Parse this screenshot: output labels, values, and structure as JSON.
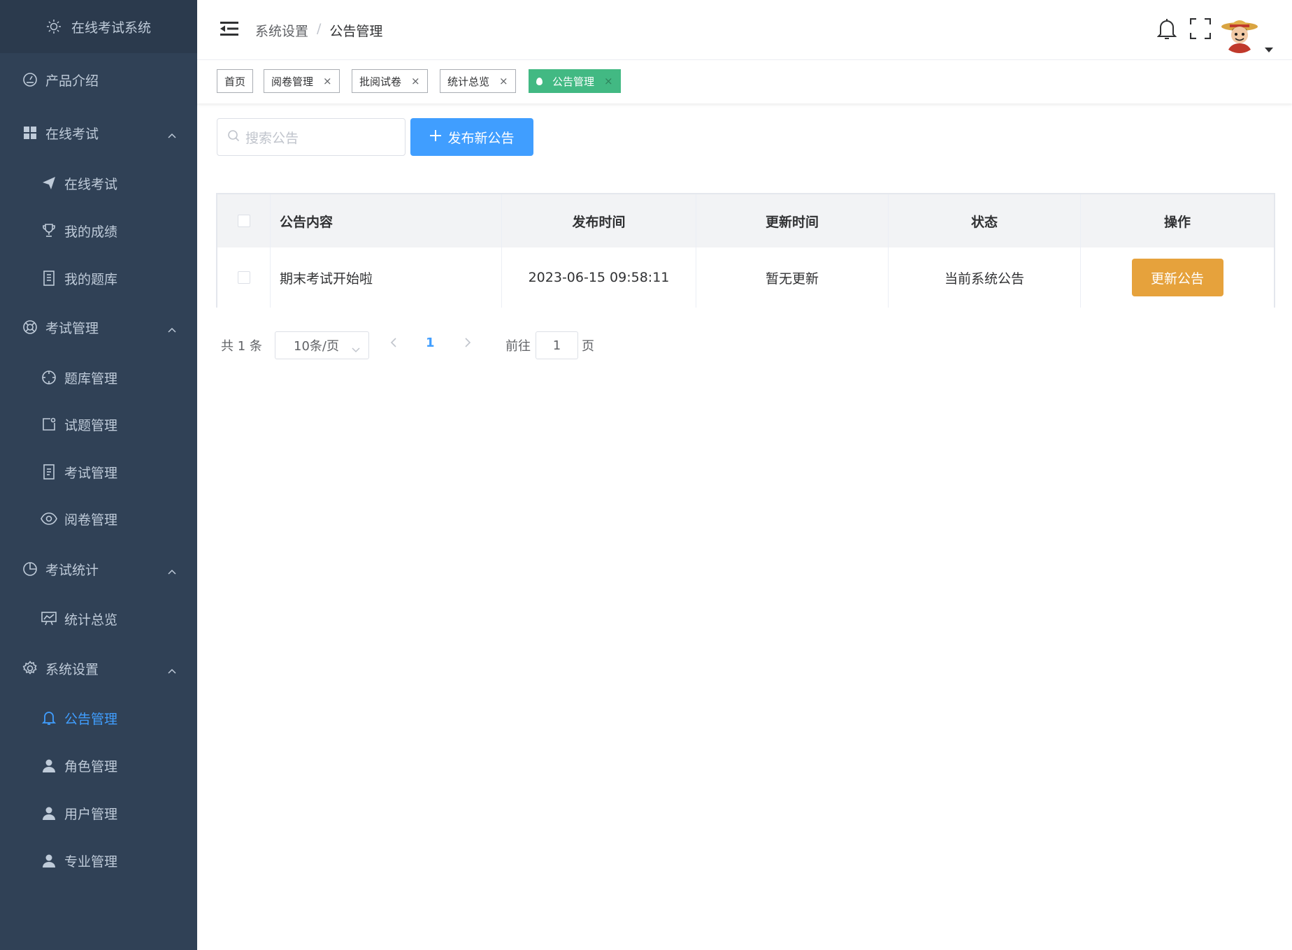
{
  "app": {
    "title": "在线考试系统"
  },
  "sidebar": {
    "items": [
      {
        "label": "产品介绍",
        "icon": "dashboard-icon"
      },
      {
        "label": "在线考试",
        "icon": "grid-icon",
        "expanded": true
      },
      {
        "label": "在线考试",
        "icon": "send-icon"
      },
      {
        "label": "我的成绩",
        "icon": "trophy-icon"
      },
      {
        "label": "我的题库",
        "icon": "notebook-icon"
      },
      {
        "label": "考试管理",
        "icon": "lifebuoy-icon",
        "expanded": true
      },
      {
        "label": "题库管理",
        "icon": "compass-icon"
      },
      {
        "label": "试题管理",
        "icon": "edit-icon"
      },
      {
        "label": "考试管理",
        "icon": "document-icon"
      },
      {
        "label": "阅卷管理",
        "icon": "eye-icon"
      },
      {
        "label": "考试统计",
        "icon": "piechart-icon",
        "expanded": true
      },
      {
        "label": "统计总览",
        "icon": "chart-board-icon"
      },
      {
        "label": "系统设置",
        "icon": "gear-icon",
        "expanded": true
      },
      {
        "label": "公告管理",
        "icon": "bell-icon",
        "active": true
      },
      {
        "label": "角色管理",
        "icon": "user-icon"
      },
      {
        "label": "用户管理",
        "icon": "user-icon"
      },
      {
        "label": "专业管理",
        "icon": "user-icon"
      }
    ]
  },
  "header": {
    "breadcrumb": [
      "系统设置",
      "公告管理"
    ],
    "breadcrumb_sep": "/"
  },
  "tags": [
    {
      "label": "首页",
      "closable": false
    },
    {
      "label": "阅卷管理",
      "closable": true
    },
    {
      "label": "批阅试卷",
      "closable": true
    },
    {
      "label": "统计总览",
      "closable": true
    },
    {
      "label": "公告管理",
      "closable": true,
      "active": true
    }
  ],
  "tag_close": "×",
  "toolbar": {
    "search_placeholder": "搜索公告",
    "publish_label": "发布新公告"
  },
  "table": {
    "columns": [
      "公告内容",
      "发布时间",
      "更新时间",
      "状态",
      "操作"
    ],
    "rows": [
      {
        "content": "期末考试开始啦",
        "published": "2023-06-15 09:58:11",
        "updated": "暂无更新",
        "status": "当前系统公告",
        "action": "更新公告"
      }
    ]
  },
  "pagination": {
    "total_text": "共 1 条",
    "page_size": "10条/页",
    "current_page": "1",
    "goto_label": "前往",
    "goto_value": "1",
    "page_suffix": "页"
  },
  "colors": {
    "sidebar_bg": "#304156",
    "primary": "#409eff",
    "success": "#42b983",
    "warning": "#e6a23c",
    "status_green": "#67c23a"
  }
}
